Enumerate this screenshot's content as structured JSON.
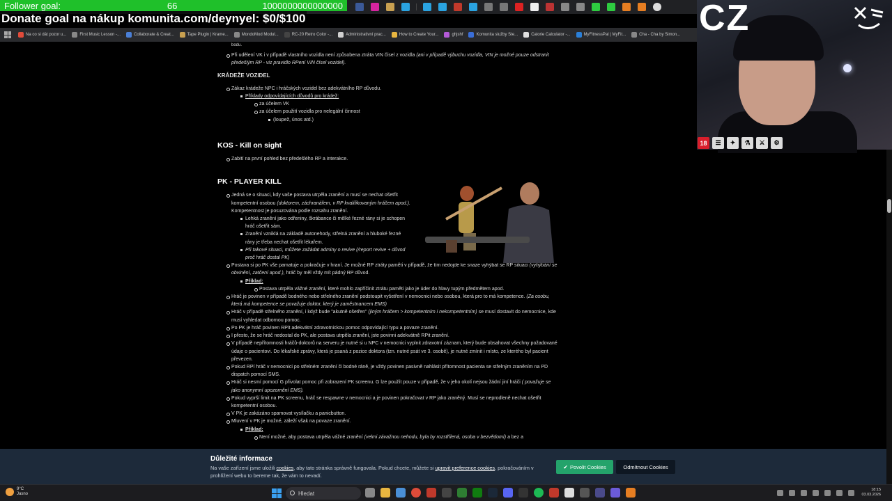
{
  "overlay": {
    "goal_label": "Follower goal:",
    "goal_current": "66",
    "goal_target": "1000000000000000",
    "donate_text": "Donate goal na nákup komunita.com/deynyel: $0/$100",
    "webcam_country": "CZ",
    "age_badge": "18"
  },
  "bookmarks": [
    {
      "label": "Na co si dát pozor u...",
      "color": "#e04b3a"
    },
    {
      "label": "First Music Lesson -...",
      "color": "#888888"
    },
    {
      "label": "Collaborate & Creat...",
      "color": "#4a7fd6"
    },
    {
      "label": "Tape Plugin | Krame...",
      "color": "#c8a050"
    },
    {
      "label": "MondoMod Modul...",
      "color": "#888888"
    },
    {
      "label": "RC-20 Retro Color -...",
      "color": "#444444"
    },
    {
      "label": "Administrativní prac...",
      "color": "#d0d0d0"
    },
    {
      "label": "How to Create Your...",
      "color": "#e8b640"
    },
    {
      "label": "ghjshf",
      "color": "#b45ad8"
    },
    {
      "label": "Komunita služby Ste...",
      "color": "#3a6ed8"
    },
    {
      "label": "Calorie Calculator -...",
      "color": "#e0e0e0"
    },
    {
      "label": "MyFitnessPal | MyFit...",
      "color": "#2a7fd8"
    },
    {
      "label": "Cha - Cha by Simon...",
      "color": "#888888"
    }
  ],
  "content": {
    "top_line1": "Při udělení VK i v případě vlastního vozidla není způsobena ztráta VIN čísel z vozidla",
    "top_line1_it": "(ani v případě výbuchu vozidla, VIN je možné pouze odstranit předešlým RP - viz pravidlo RPení VIN čísel vozidel).",
    "theft_title": "KRÁDEŽE VOZIDEL",
    "theft_rule": "Zákaz krádeže NPC i hráčských vozidel bez adekvátního RP důvodu.",
    "theft_examples": "Příklady odpovídajících důvodů pro krádež:",
    "theft_ex1": "za účelem VK",
    "theft_ex2": "za účelem použití vozidla pro nelegální činnost",
    "theft_ex3": "(loupež, únos atd.)",
    "kos_title": "KOS -  Kill on sight",
    "kos_rule": "Zabití na první pohled bez předešlého RP a interakce.",
    "pk_title": "PK - PLAYER KILL",
    "pk1a": "Jedná se o situaci, kdy vaše postava utrpěla zranění a musí se nechat ošetřit kompetentní osobou",
    "pk1b": "(doktorem, záchranářem, v RP kvalifikovaným hráčem apod.).",
    "pk1c": "Kompetentnost je posuzována podle rozsahu zranění.",
    "pk1_sub1": "Lehká zranění jako odřeniny, škrábance či mělké řezné rány si je schopen hráč ošetřit sám.",
    "pk1_sub2": "Zranění vzniklá na základě autonehody, střelná zranění a hluboké řezné rány je třeba nechat ošetřit lékařem.",
    "pk1_sub3": "Při takové situaci, můžete zažádat adminy o revive (/report revive + důvod proč hráč dostal PK)",
    "pk2a": "Postava si po PK vše pamatuje a pokračuje v hraní. Je možné RP ztráty paměti v případě, že tím nedojde ke snaze vyhýbat se RP situaci",
    "pk2b": "(vyhýbání se obvinění, zatčení apod.),",
    "pk2c": "hráč by měl vždy mít pádný RP důvod.",
    "pk2_example": "Příklad:",
    "pk2_ex1": "Postava utrpěla vážné zranění, které mohlo zapříčinit ztrátu paměti jako je úder do hlavy tupým předmětem apod.",
    "pk3a": "Hráč je povinen v případě bodného nebo střelného zranění podstoupit vyšetření v nemocnici nebo osobou, která pro to má kompetence.",
    "pk3b": "(Za osobu, která má kompetence se považuje doktor, který je zaměstnancem EMS)",
    "pk4a": "Hráč v případě střelného zranění, i když bude \"akutně ošetřen\"",
    "pk4b": "(jiným hráčem > kompetentním i nekompetentním)",
    "pk4c": "se musí dostavit do nemocnice, kde musí vyhledat odbornou pomoc.",
    "pk5": "Po PK je hráč povinen RPit adekvátní zdravotnickou pomoc odpovídající typu a povaze zranění.",
    "pk6": "I přesto, že se hráč nedostal do PK, ale postava utrpěla zranění, jste povinni adekvátně RPit zranění.",
    "pk7": "V případě nepřítomnosti hráčů-doktorů na serveru je nutné si u NPC v nemocnici vyplnit zdravotní záznam, který bude obsahovat všechny požadované údaje o pacientovi. Do lékařské zprávy, která je psaná z pozice doktora (tzn. nutné psát ve 3. osobě), je nutné zmínit i místo, ze kterého byl pacient převezen.",
    "pk8": "Pokud RPí hráč v nemocnici po střelném zranění či bodné ráně, je vždy povinen pasivně nahlásit přítomnost pacienta se střelným zraněním na PD dispatch pomocí SMS.",
    "pk9a": "Hráč si nesmí pomocí G přivolat pomoc při zobrazení PK screenu. G lze použít pouze v případě, že v jeho okolí nejsou žádní jiní hráči",
    "pk9b": "( považuje se jako anonymní upozornění EMS).",
    "pk10": "Pokud vyprší limit na PK screenu, hráč se respawne v nemocnici a je povinen pokračovat v RP jako zraněný. Musí se neprodleně nechat ošetřit kompetentní osobou.",
    "pk11": "V PK je zakázáno spamovat vysílačku a panicbutton.",
    "pk12": "Mluvení v PK je možné, záleží však na povaze zranění.",
    "pk12_example": "Příklad:",
    "pk12_ex1a": "Není možné, aby postava utrpěla vážné zranění",
    "pk12_ex1b": "(velmi závažnou nehodu, byla by rozstřílená, osoba v bezvědomí)",
    "pk12_ex1c": "a bez a"
  },
  "cookie": {
    "title": "Důležité informace",
    "text1": "Na vaše zařízení jsme uložili",
    "link1": "cookies",
    "text2": ", aby tato stránka správně fungovala. Pokud chcete, můžete si",
    "link2": "upravit preference cookies",
    "text3": ", pokračováním v prohlížení webu to bereme tak, že vám to nevadí.",
    "accept_label": "Povolit Cookies",
    "reject_label": "Odmítnout Cookies"
  },
  "taskbar": {
    "weather_temp": "9°C",
    "weather_desc": "Jasno",
    "search_placeholder": "Hledat",
    "time": "18:15",
    "date": "03.03.2026"
  },
  "colors": {
    "goal_green": "#1fc02a",
    "cookie_bg": "#1d2a3a",
    "accept_green": "#24a36b"
  }
}
